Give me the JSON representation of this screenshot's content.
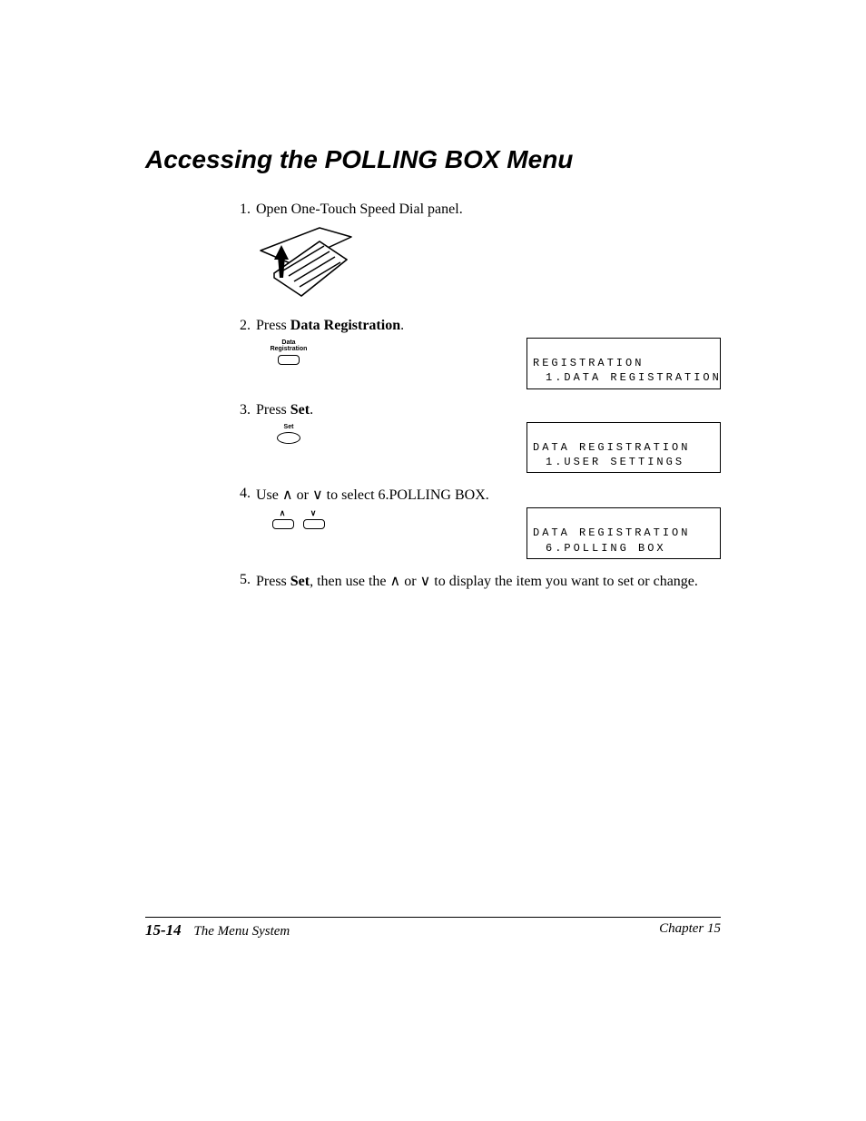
{
  "title": "Accessing the POLLING BOX Menu",
  "steps": {
    "s1": {
      "num": "1.",
      "text": "Open One-Touch Speed Dial panel."
    },
    "s2": {
      "num": "2.",
      "pre": "Press ",
      "bold": "Data Registration",
      "post": "."
    },
    "s3": {
      "num": "3.",
      "pre": "Press ",
      "bold": "Set",
      "post": "."
    },
    "s4": {
      "num": "4.",
      "pre": "Use ",
      "mid": " or ",
      "post": " to select 6.POLLING BOX."
    },
    "s5": {
      "num": "5.",
      "pre": "Press ",
      "bold": "Set",
      "mid1": ", then use the ",
      "mid2": " or ",
      "post": " to display the item you want to set or change."
    }
  },
  "buttons": {
    "data_reg_label1": "Data",
    "data_reg_label2": "Registration",
    "set_label": "Set",
    "up": "∧",
    "down": "∨"
  },
  "lcd": {
    "d1l1": "REGISTRATION",
    "d1l2": "1.DATA REGISTRATION",
    "d2l1": "DATA REGISTRATION",
    "d2l2": "1.USER SETTINGS",
    "d3l1": "DATA REGISTRATION",
    "d3l2": "6.POLLING BOX"
  },
  "footer": {
    "page": "15-14",
    "section": "The Menu System",
    "chapter": "Chapter 15"
  }
}
